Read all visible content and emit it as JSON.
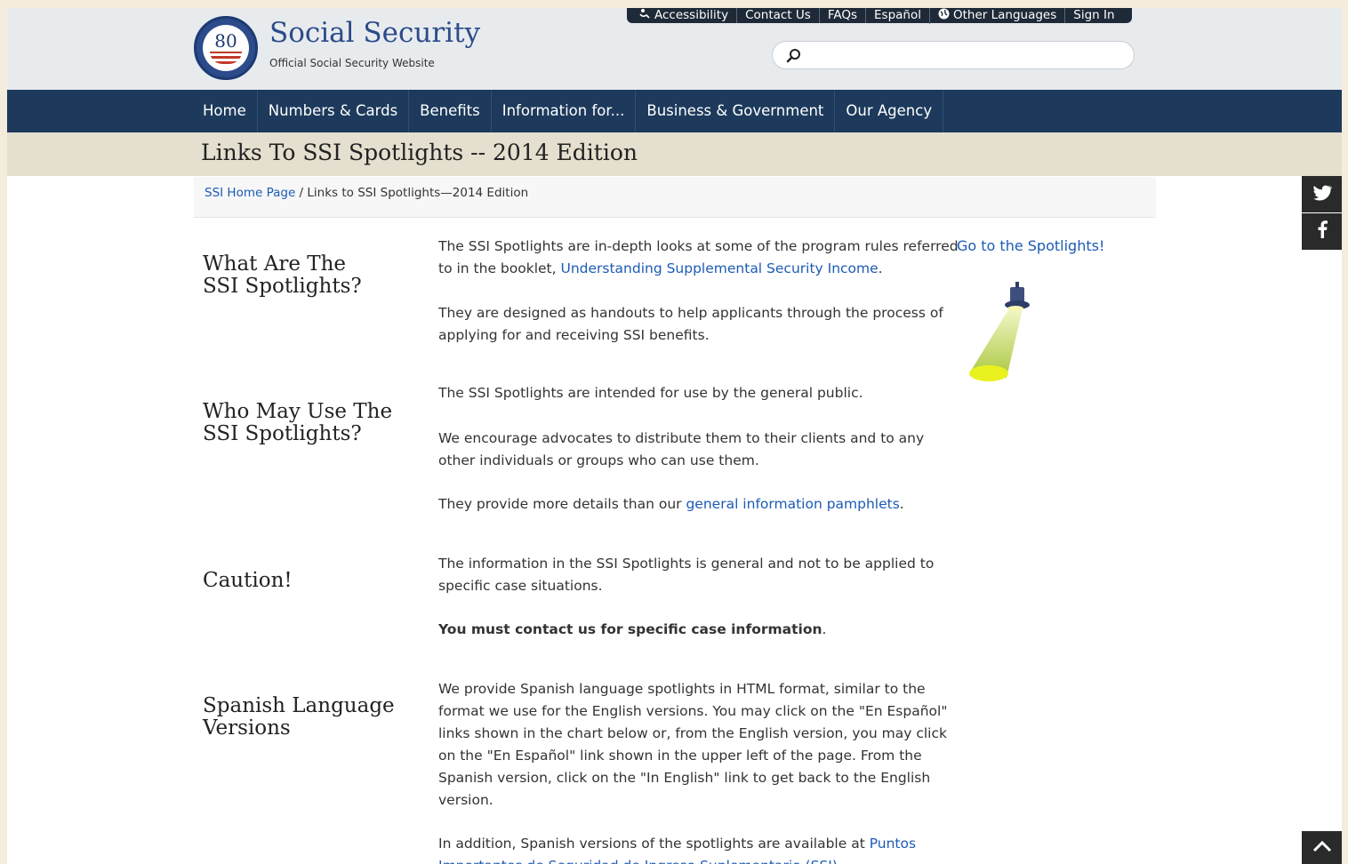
{
  "header": {
    "seal_text": "80",
    "brand_title": "Social Security",
    "brand_subtitle": "Official Social Security Website"
  },
  "utility_nav": [
    {
      "label": "Accessibility",
      "icon": "accessibility-icon"
    },
    {
      "label": "Contact Us"
    },
    {
      "label": "FAQs"
    },
    {
      "label": "Español"
    },
    {
      "label": "Other Languages",
      "icon": "globe-icon"
    },
    {
      "label": "Sign In"
    }
  ],
  "search": {
    "placeholder": "",
    "value": ""
  },
  "main_nav": [
    "Home",
    "Numbers & Cards",
    "Benefits",
    "Information for...",
    "Business & Government",
    "Our Agency"
  ],
  "page_title": "Links To SSI Spotlights -- 2014 Edition",
  "breadcrumb": {
    "home_link": "SSI Home Page",
    "separator": " / ",
    "current": "Links to SSI Spotlights—2014 Edition"
  },
  "spotlight_link": "Go to the Spotlights!",
  "sections": {
    "what": {
      "heading_line1": "What Are The",
      "heading_line2": "SSI Spotlights?",
      "p1_text": "The SSI Spotlights are in-depth looks at some of the program rules referred to in the booklet, ",
      "p1_link": "Understanding Supplemental Security Income",
      "p1_end": ".",
      "p2": "They are designed as handouts to help applicants through the process of applying for and receiving SSI benefits."
    },
    "who": {
      "heading_line1": "Who May Use The",
      "heading_line2": "SSI Spotlights?",
      "p1": "The SSI Spotlights are intended for use by the general public.",
      "p2": "We encourage advocates to distribute them to their clients and to any other individuals or groups who can use them.",
      "p3_text": "They provide more details than our ",
      "p3_link": "general information pamphlets",
      "p3_end": "."
    },
    "caution": {
      "heading": "Caution!",
      "p1": "The information in the SSI Spotlights is general and not to be applied to specific case situations.",
      "p2_bold": "You must contact us for specific case information",
      "p2_end": "."
    },
    "spanish": {
      "heading_line1": "Spanish Language",
      "heading_line2": "Versions",
      "p1": "We provide Spanish language spotlights in HTML format, similar to the format we use for the English versions. You may click on the \"En Español\" links shown in the chart below or, from the English version, you may click on the \"En Español\" link shown in the upper left of the page. From the Spanish version, click on the \"In English\" link to get back to the English version.",
      "p2_text": "In addition, Spanish versions of the spotlights are available at ",
      "p2_link": "Puntos Importantes de Seguridad de Ingreso Suplementario (SSI)"
    }
  },
  "social": {
    "twitter": "twitter-icon",
    "facebook": "facebook-icon",
    "back_to_top": "chevron-up-icon"
  },
  "colors": {
    "nav_bg": "#1d3a5c",
    "link": "#1c5bb5",
    "title_band": "#e5dfcf",
    "header_bg": "#e8ebee"
  }
}
